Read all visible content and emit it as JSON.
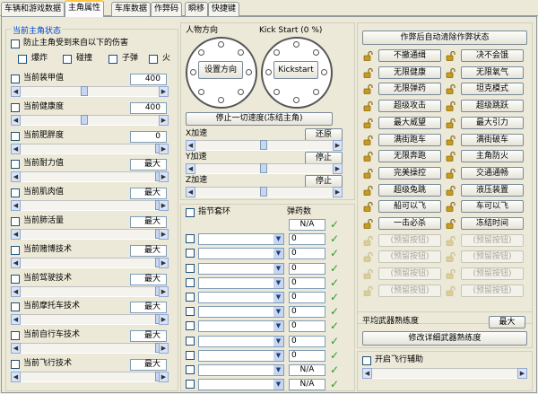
{
  "tabs": [
    "车辆和游戏数据",
    "主角属性",
    "车库数据",
    "作弊码",
    "瞬移",
    "快捷键"
  ],
  "active_tab": 1,
  "status": {
    "title": "当前主角状态",
    "protect_label": "防止主角受到来自以下的伤害",
    "dmg": [
      "爆炸",
      "碰撞",
      "子弹",
      "火"
    ],
    "attrs": [
      {
        "label": "当前装甲值",
        "value": "400"
      },
      {
        "label": "当前健康度",
        "value": "400"
      },
      {
        "label": "当前肥胖度",
        "value": "0"
      },
      {
        "label": "当前耐力值",
        "value": "最大"
      },
      {
        "label": "当前肌肉值",
        "value": "最大"
      },
      {
        "label": "当前肺活量",
        "value": "最大"
      },
      {
        "label": "当前赌博技术",
        "value": "最大"
      },
      {
        "label": "当前驾驶技术",
        "value": "最大"
      },
      {
        "label": "当前摩托车技术",
        "value": "最大"
      },
      {
        "label": "当前自行车技术",
        "value": "最大"
      },
      {
        "label": "当前飞行技术",
        "value": "最大"
      }
    ]
  },
  "direction": {
    "label": "人物方向",
    "set_btn": "设置方向"
  },
  "kickstart": {
    "label": "Kick Start (0 %)",
    "btn": "Kickstart"
  },
  "stop_btn": "停止一切速度(冻结主角)",
  "accel": [
    {
      "label": "X加速",
      "btn": "还原"
    },
    {
      "label": "Y加速",
      "btn": "停止"
    },
    {
      "label": "Z加速",
      "btn": "停止"
    }
  ],
  "ammo": {
    "head_label": "指节套环",
    "ammo_label": "弹药数",
    "rows": [
      "N/A",
      "0",
      "0",
      "0",
      "0",
      "0",
      "0",
      "0",
      "0",
      "0",
      "N/A",
      "N/A"
    ]
  },
  "cheats": {
    "clear_btn": "作弊后自动清除作弊状态",
    "rows": [
      [
        "不撤通缉",
        "决不会饿"
      ],
      [
        "无限健康",
        "无限氧气"
      ],
      [
        "无限弹药",
        "坦克模式"
      ],
      [
        "超级攻击",
        "超级跳跃"
      ],
      [
        "最大威望",
        "最大引力"
      ],
      [
        "满街跑车",
        "满街破车"
      ],
      [
        "无限奔跑",
        "主角防火"
      ],
      [
        "完美操控",
        "交通通畅"
      ],
      [
        "超级兔跳",
        "液压装置"
      ],
      [
        "船可以飞",
        "车可以飞"
      ],
      [
        "一击必杀",
        "冻结时间"
      ]
    ],
    "placeholder": "(预留按钮)",
    "placeholder_rows": 4
  },
  "weapon": {
    "label": "平均武器熟练度",
    "value": "最大",
    "modify_btn": "修改详细武器熟练度"
  },
  "fly_assist": "开启飞行辅助",
  "colors": {
    "blue_label": "#0046d5",
    "tick": "#2a9a2a",
    "lock": "#c89a1e"
  },
  "icons": [
    "checkbox-icon",
    "lock-open-icon",
    "checkmark-icon",
    "dropdown-arrow-icon",
    "scroll-arrow-icon"
  ]
}
